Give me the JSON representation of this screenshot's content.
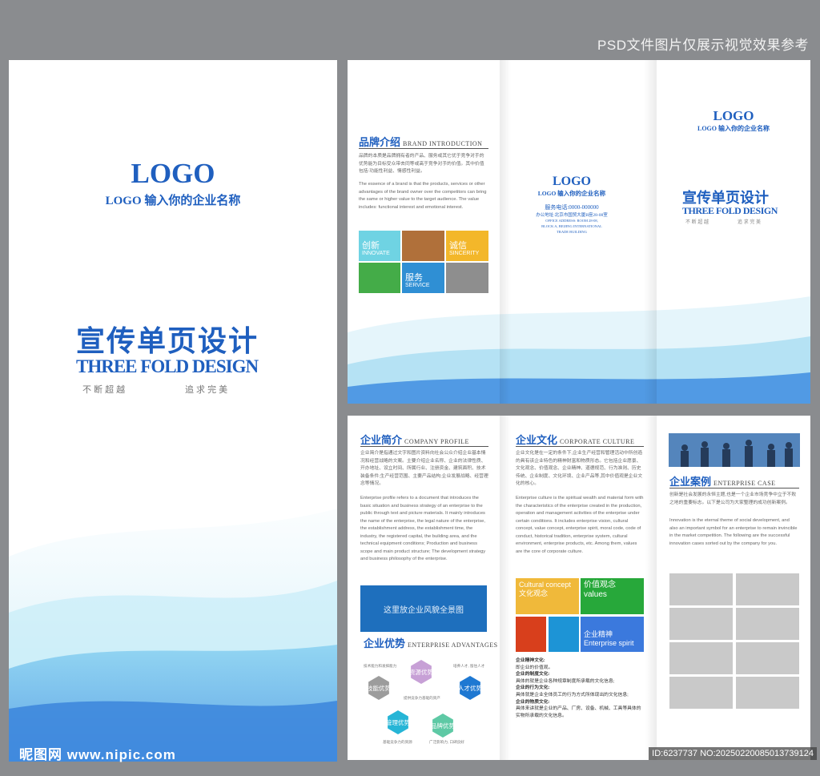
{
  "caption": "PSD文件图片仅展示视觉效果参考",
  "watermark": {
    "site": "昵图网 www.nipic.com",
    "id_text": "ID:6237737 NO:20250220085013739124"
  },
  "cover": {
    "logo": "LOGO",
    "company": "LOGO 输入你的企业名称",
    "title_cn": "宣传单页设计",
    "title_en": "THREE FOLD DESIGN",
    "slogan_a": "不 断 超 越",
    "slogan_b": "追 求 完 美"
  },
  "outside": {
    "brand": {
      "title": "品牌介绍",
      "title_en": "BRAND INTRODUCTION",
      "text_cn": "品牌的本质是品牌拥有者的产品、服务或其它优于竞争对手的优势能为目标受众带去同等或高于竞争对手的价值。其中价值包括:功能性利益、情感性利益。",
      "text_en": "The essence of a brand is that the products, services or other advantages of the brand owner over the competitors can bring the same or higher value to the target audience. The value includes: functional interest and emotional interest."
    },
    "tiles": [
      {
        "cn": "创新",
        "en": "INNOVATE"
      },
      {
        "cn": "诚信",
        "en": "SINCERITY"
      },
      {
        "cn": "服务",
        "en": "SERVICE"
      }
    ],
    "back": {
      "logo": "LOGO",
      "company": "LOGO 输入你的企业名称",
      "phone": "服务电话:0000-000000",
      "address": "办公地址:北京市国贸大厦B座28-08室",
      "address_en_1": "OFFICE ADDRESS: ROOM 28-08,",
      "address_en_2": "BLOCK A, BEIJING INTERNATIONAL",
      "address_en_3": "TRADE BUILDING"
    },
    "front": {
      "logo": "LOGO",
      "company": "LOGO 输入你的企业名称",
      "title_cn": "宣传单页设计",
      "title_en": "THREE FOLD DESIGN",
      "slogan_a": "不 断 超 越",
      "slogan_b": "追 求 完 美"
    }
  },
  "inside": {
    "profile": {
      "title": "企业简介",
      "title_en": "COMPANY PROFILE",
      "text_cn": "企业简介是指通过文字和图片资料向社会公众介绍企业基本情况和经营战略的文案。主要介绍企业名称、企业的法律性质、开办地址、设立时间、所属行业、注册资金、建筑面积、技术装备条件;生产经营范围、主要产品结构;企业发展战略、经营理念等情况。",
      "text_en": "Enterprise profile refers to a document that introduces the basic situation and business strategy of an enterprise to the public through text and picture materials. It mainly introduces the name of the enterprise, the legal nature of the enterprise, the establishment address, the establishment time, the industry, the registered capital, the building area, and the technical equipment conditions; Production and business scope and main product structure; The development strategy and business philosophy of the enterprise.",
      "banner": "这里放企业风貌全景图"
    },
    "advantages": {
      "title": "企业优势",
      "title_en": "ENTERPRISE ADVANTAGES",
      "hexes": [
        "技能优势",
        "资源优势",
        "人才优势",
        "管理优势",
        "品牌优势"
      ],
      "notes": [
        "技术能力和发挥能力",
        "培养人才, 留住人才",
        "提供竞争力基础的资产",
        "基础竞争力的资源",
        "广泛影响力, 口碑良好"
      ]
    },
    "culture": {
      "title": "企业文化",
      "title_en": "CORPORATE CULTURE",
      "text_cn": "企业文化是在一定的条件下,企业生产经营和管理活动中所创造的具有该企业特色的精神财富和物质形态。它包括企业愿景、文化观念、价值观念、企业精神、道德规范、行为准则、历史传统、企业制度、文化环境、企业产品等,其中价值观是企业文化的核心。",
      "text_en": "Enterprise culture is the spiritual wealth and material form with the characteristics of the enterprise created in the production, operation and management activities of the enterprise under certain conditions. It includes enterprise vision, cultural concept, value concept, enterprise spirit, moral code, code of conduct, historical tradition, enterprise system, cultural environment, enterprise products, etc. Among them, values are the core of corporate culture.",
      "tiles": [
        {
          "a": "Cultural concept",
          "b": "文化观念"
        },
        {
          "a": "价值观念",
          "b": "values"
        },
        {
          "a": "企业精神",
          "b": "Enterprise spirit"
        }
      ],
      "list": [
        {
          "h": "企业精神文化:",
          "t": "即企业的价值观。"
        },
        {
          "h": "企业的制度文化:",
          "t": "具体的就是企业各种规章制度所承载的文化信息;"
        },
        {
          "h": "企业的行为文化:",
          "t": "具体就是企业全体员工的行为方式所体现出的文化信息;"
        },
        {
          "h": "企业的物质文化:",
          "t": "具体来讲就是企业的产品、厂房、设备、机械、工具等具体的实物所承载的文化信息。"
        }
      ]
    },
    "cases": {
      "title": "企业案例",
      "title_en": "ENTERPRISE CASE",
      "text_cn": "创新是社会发展的永恒主题,也是一个企业市场竞争中立于不败之地的重要标志。以下是公司为大家整理的成功创新案例。",
      "text_en": "Innovation is the eternal theme of social development, and also an important symbol for an enterprise to remain invincible in the market competition. The following are the successful innovation cases sorted out by the company for you."
    }
  }
}
